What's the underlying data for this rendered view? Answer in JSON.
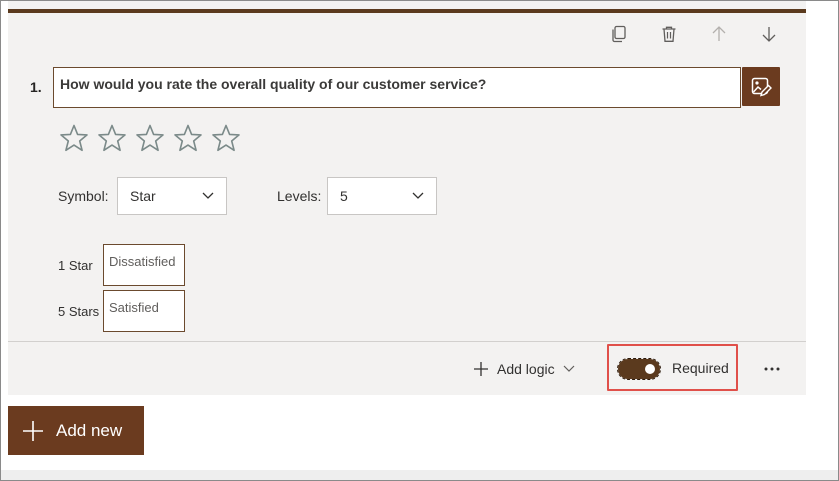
{
  "question": {
    "number": "1.",
    "text": "How would you rate the overall quality of our customer service?",
    "rating_icons": [
      "star-outline-icon",
      "star-outline-icon",
      "star-outline-icon",
      "star-outline-icon",
      "star-outline-icon"
    ],
    "symbol_label": "Symbol:",
    "symbol_value": "Star",
    "levels_label": "Levels:",
    "levels_value": "5",
    "scale": {
      "low_label": "1 Star",
      "low_value": "Dissatisfied",
      "high_label": "5 Stars",
      "high_value": "Satisfied"
    }
  },
  "toolbar": {
    "icons": [
      "copy-icon",
      "delete-icon",
      "move-up-icon",
      "move-down-icon"
    ]
  },
  "footer": {
    "add_logic_label": "Add logic",
    "required_label": "Required",
    "required_on": true
  },
  "add_new_label": "Add new",
  "colors": {
    "accent": "#6b3b1f",
    "topbar": "#5b3a1e",
    "card_bg": "#f3f2f1",
    "highlight": "#e0504a"
  }
}
